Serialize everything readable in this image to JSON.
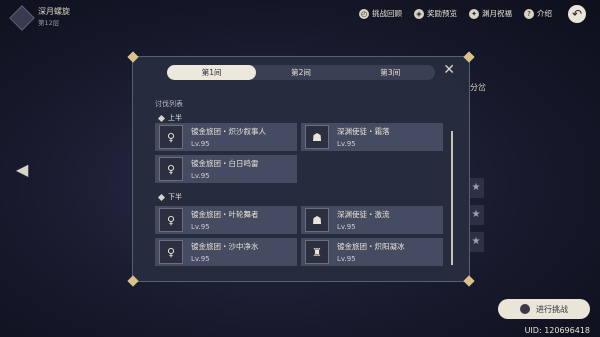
{
  "header": {
    "title": "深月螺旋",
    "subtitle": "第12层",
    "menu": [
      {
        "label": "挑战回顾",
        "icon": "replay-icon"
      },
      {
        "label": "奖励预览",
        "icon": "gift-icon"
      },
      {
        "label": "渊月祝福",
        "icon": "blessing-icon"
      },
      {
        "label": "介绍",
        "icon": "info-icon"
      }
    ]
  },
  "background": {
    "right_label": "分岔",
    "uid": "UID: 120696418",
    "start_button": "进行挑战"
  },
  "modal": {
    "tabs": [
      {
        "label": "第1间",
        "active": true
      },
      {
        "label": "第2间",
        "active": false
      },
      {
        "label": "第3间",
        "active": false
      }
    ],
    "section_title": "讨伐列表",
    "first_half": {
      "label": "上半",
      "enemies": [
        {
          "name": "镀金旅团・炽沙叙事人",
          "level": "Lv.95",
          "icon": "female-warrior-icon"
        },
        {
          "name": "深渊使徒・霜落",
          "level": "Lv.95",
          "icon": "abyss-herald-icon"
        },
        {
          "name": "镀金旅团・白日鸣雷",
          "level": "Lv.95",
          "icon": "female-warrior-icon"
        }
      ]
    },
    "second_half": {
      "label": "下半",
      "enemies": [
        {
          "name": "镀金旅团・叶轮舞者",
          "level": "Lv.95",
          "icon": "female-warrior-icon"
        },
        {
          "name": "深渊使徒・激流",
          "level": "Lv.95",
          "icon": "abyss-herald-icon"
        },
        {
          "name": "镀金旅团・沙中净水",
          "level": "Lv.95",
          "icon": "female-warrior-icon"
        },
        {
          "name": "镀金旅团・炽阳凝冰",
          "level": "Lv.95",
          "icon": "armored-warrior-icon"
        }
      ]
    }
  }
}
